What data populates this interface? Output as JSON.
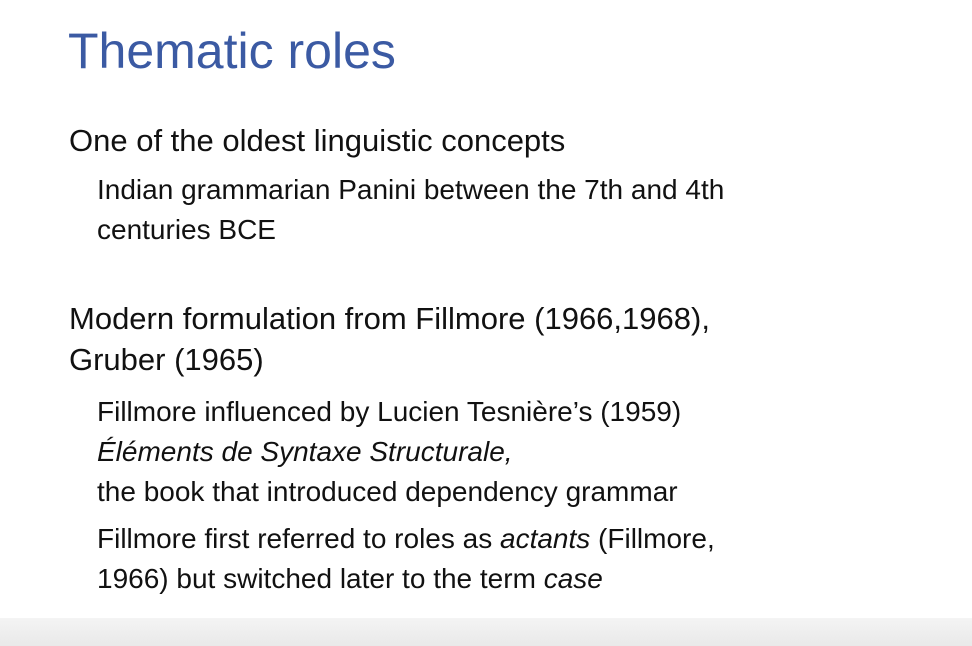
{
  "slide": {
    "title": "Thematic roles",
    "sections": [
      {
        "heading": "One of the oldest linguistic concepts",
        "sub_lines": [
          "Indian grammarian Panini between the 7th and 4th",
          "centuries BCE"
        ]
      },
      {
        "heading_lines": [
          "Modern formulation from Fillmore (1966,1968),",
          "Gruber (1965)"
        ],
        "point_a": {
          "line1": "Fillmore influenced by Lucien Tesnière’s (1959)",
          "line2_italic": "Éléments de Syntaxe Structurale,",
          "line3": "the book that introduced dependency grammar"
        },
        "point_b": {
          "line1_pre": "Fillmore first referred to roles as ",
          "line1_italic": "actants",
          "line1_post": " (Fillmore,",
          "line2_pre": "1966) but switched later to the term ",
          "line2_italic": "case"
        }
      }
    ]
  }
}
